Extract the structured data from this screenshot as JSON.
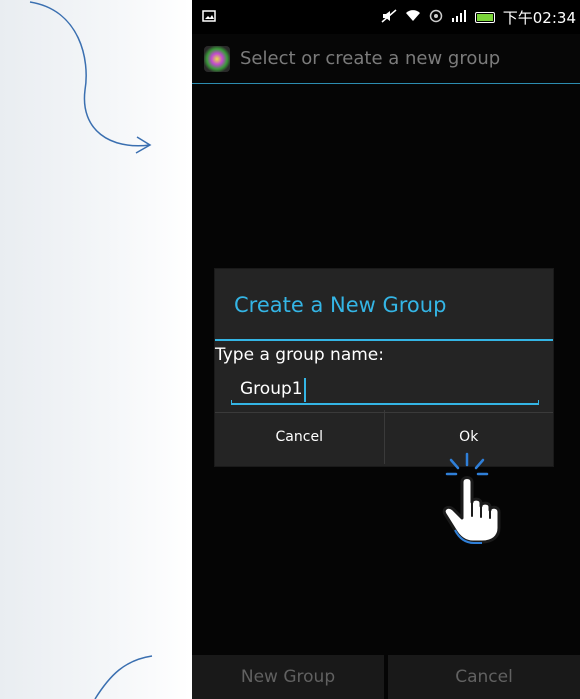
{
  "status_bar": {
    "time": "下午02:34",
    "icons": [
      "picture-icon",
      "mute-icon",
      "wifi-icon",
      "sync-icon",
      "signal-icon",
      "battery-icon"
    ]
  },
  "app_bar": {
    "title": "Select or create a new group",
    "icon": "app-logo-icon"
  },
  "dialog": {
    "title": "Create a New Group",
    "label": "Type a group name:",
    "input_value": "Group1",
    "cancel_label": "Cancel",
    "ok_label": "Ok"
  },
  "bottom_bar": {
    "new_group_label": "New Group",
    "cancel_label": "Cancel"
  },
  "colors": {
    "accent": "#34b5e5",
    "dialog_bg": "#242424",
    "screen_bg": "#050505"
  }
}
